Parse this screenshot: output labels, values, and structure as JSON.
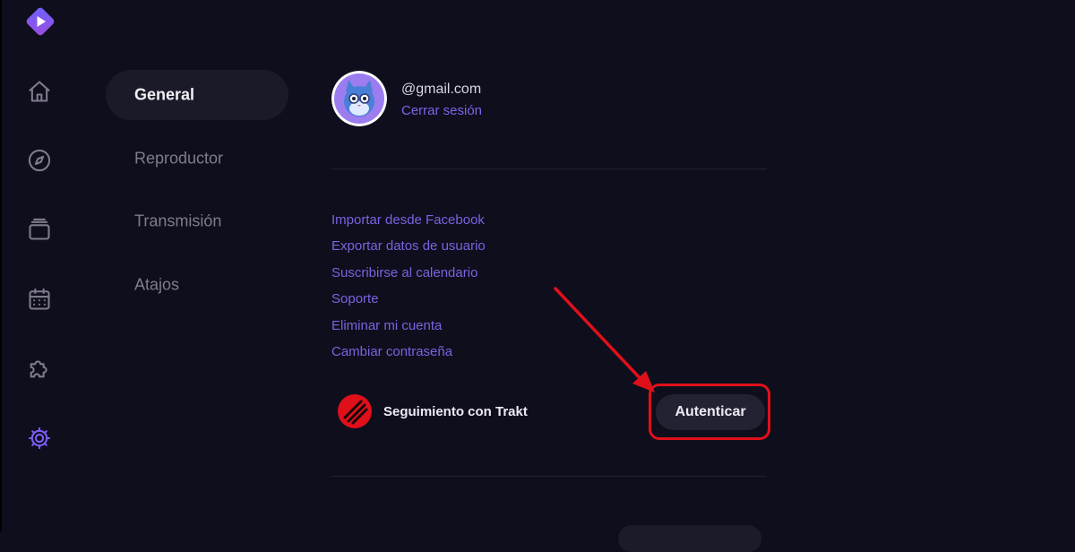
{
  "nav": {
    "items": [
      {
        "label": "General",
        "active": true
      },
      {
        "label": "Reproductor",
        "active": false
      },
      {
        "label": "Transmisión",
        "active": false
      },
      {
        "label": "Atajos",
        "active": false
      }
    ]
  },
  "profile": {
    "email": "@gmail.com",
    "logout_label": "Cerrar sesión"
  },
  "links": [
    "Importar desde Facebook",
    "Exportar datos de usuario",
    "Suscribirse al calendario",
    "Soporte",
    "Eliminar mi cuenta",
    "Cambiar contraseña"
  ],
  "trakt": {
    "label": "Seguimiento con Trakt",
    "button_label": "Autenticar"
  },
  "rail_icons": [
    "home-icon",
    "compass-icon",
    "library-icon",
    "calendar-icon",
    "puzzle-icon",
    "settings-gear-icon"
  ],
  "colors": {
    "background": "#0f0e1d",
    "accent": "#7b5cf5",
    "link": "#7a63e0",
    "highlight": "#e0101a"
  }
}
